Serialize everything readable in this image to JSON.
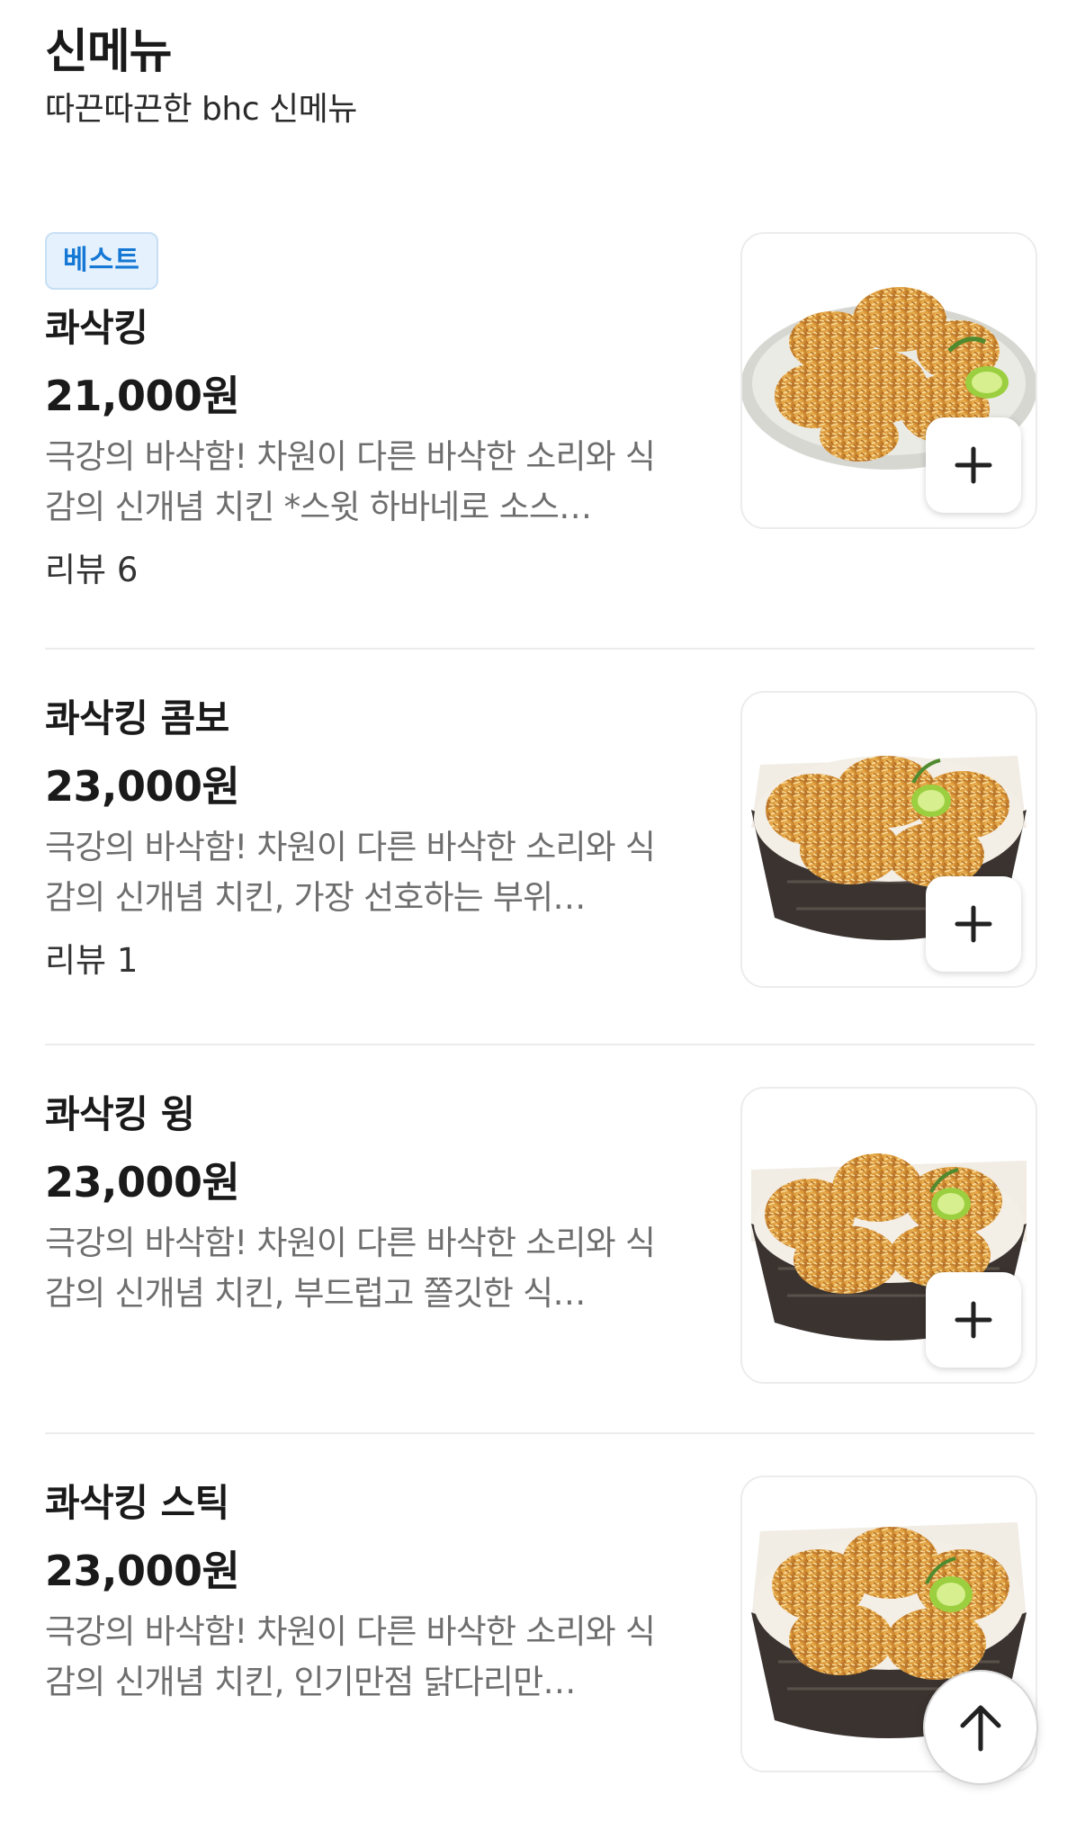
{
  "header": {
    "title": "신메뉴",
    "subtitle": "따끈따끈한  bhc 신메뉴"
  },
  "items": [
    {
      "badge": "베스트",
      "name": "콰삭킹",
      "price": "21,000원",
      "description": "극강의 바삭함! 차원이 다른 바삭한 소리와 식감의 신개념 치킨 *스윗 하바네로 소스…",
      "review": "리뷰 6",
      "image": "fried-chicken-plate",
      "add_icon": "plus-icon"
    },
    {
      "name": "콰삭킹 콤보",
      "price": "23,000원",
      "description": "극강의 바삭함! 차원이 다른 바삭한 소리와 식감의 신개념 치킨, 가장 선호하는 부위…",
      "review": "리뷰 1",
      "image": "fried-chicken-basket",
      "add_icon": "plus-icon"
    },
    {
      "name": "콰삭킹 윙",
      "price": "23,000원",
      "description": "극강의 바삭함! 차원이 다른 바삭한 소리와 식감의 신개념 치킨, 부드럽고 쫄깃한 식…",
      "image": "fried-chicken-wings-basket",
      "add_icon": "plus-icon"
    },
    {
      "name": "콰삭킹 스틱",
      "price": "23,000원",
      "description": "극강의 바삭함! 차원이 다른 바삭한 소리와 식감의 신개념 치킨, 인기만점 닭다리만…",
      "image": "fried-chicken-sticks-basket",
      "add_icon": "plus-icon"
    }
  ],
  "scroll_top_icon": "arrow-up-icon",
  "colors": {
    "badge_bg": "#e5f1fc",
    "badge_text": "#1478d4",
    "text_primary": "#1a1a1a",
    "text_secondary": "#6e6e6e",
    "divider": "#ececec"
  }
}
